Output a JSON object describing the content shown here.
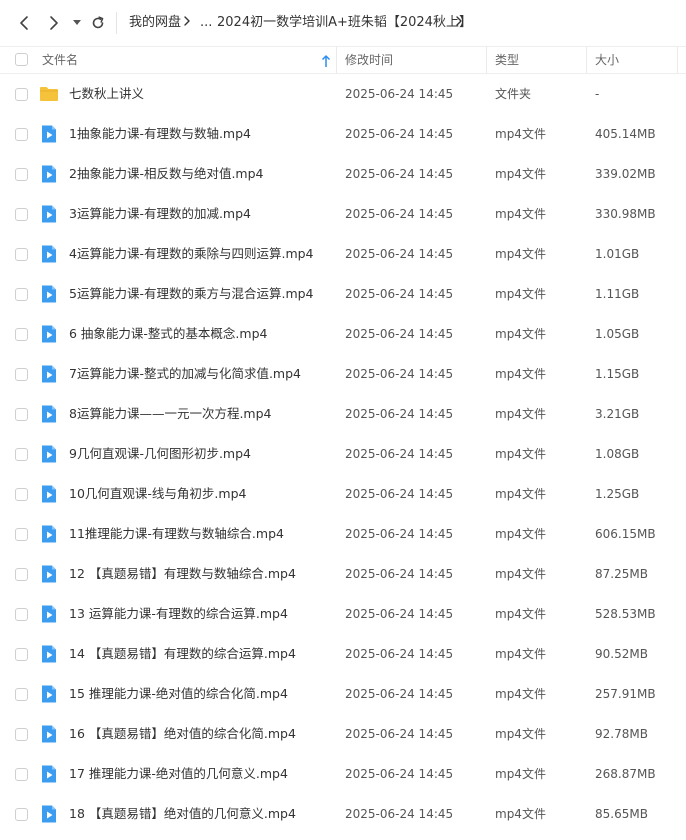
{
  "colors": {
    "folder": "#f5c23b",
    "video_icon": "#3c9cf0",
    "sort_arrow": "#2b8ef0",
    "text": "#333333"
  },
  "nav": {
    "back_icon": "chevron-left-icon",
    "forward_icon": "chevron-right-icon",
    "history_icon": "caret-down-icon",
    "refresh_icon": "refresh-icon",
    "breadcrumb": [
      "我的网盘",
      "...",
      "2024初一数学培训A+班朱韬【2024秋上】"
    ]
  },
  "header": {
    "name": "文件名",
    "time": "修改时间",
    "type": "类型",
    "size": "大小",
    "sort_icon": "sort-up-arrow-icon"
  },
  "files": [
    {
      "name": "七数秋上讲义",
      "time": "2025-06-24 14:45",
      "type": "文件夹",
      "size": "-",
      "kind": "folder"
    },
    {
      "name": "1抽象能力课-有理数与数轴.mp4",
      "time": "2025-06-24 14:45",
      "type": "mp4文件",
      "size": "405.14MB",
      "kind": "video"
    },
    {
      "name": "2抽象能力课-相反数与绝对值.mp4",
      "time": "2025-06-24 14:45",
      "type": "mp4文件",
      "size": "339.02MB",
      "kind": "video"
    },
    {
      "name": "3运算能力课-有理数的加减.mp4",
      "time": "2025-06-24 14:45",
      "type": "mp4文件",
      "size": "330.98MB",
      "kind": "video"
    },
    {
      "name": "4运算能力课-有理数的乘除与四则运算.mp4",
      "time": "2025-06-24 14:45",
      "type": "mp4文件",
      "size": "1.01GB",
      "kind": "video"
    },
    {
      "name": "5运算能力课-有理数的乘方与混合运算.mp4",
      "time": "2025-06-24 14:45",
      "type": "mp4文件",
      "size": "1.11GB",
      "kind": "video"
    },
    {
      "name": "6 抽象能力课-整式的基本概念.mp4",
      "time": "2025-06-24 14:45",
      "type": "mp4文件",
      "size": "1.05GB",
      "kind": "video"
    },
    {
      "name": "7运算能力课-整式的加减与化简求值.mp4",
      "time": "2025-06-24 14:45",
      "type": "mp4文件",
      "size": "1.15GB",
      "kind": "video"
    },
    {
      "name": "8运算能力课——一元一次方程.mp4",
      "time": "2025-06-24 14:45",
      "type": "mp4文件",
      "size": "3.21GB",
      "kind": "video"
    },
    {
      "name": "9几何直观课-几何图形初步.mp4",
      "time": "2025-06-24 14:45",
      "type": "mp4文件",
      "size": "1.08GB",
      "kind": "video"
    },
    {
      "name": "10几何直观课-线与角初步.mp4",
      "time": "2025-06-24 14:45",
      "type": "mp4文件",
      "size": "1.25GB",
      "kind": "video"
    },
    {
      "name": "11推理能力课-有理数与数轴综合.mp4",
      "time": "2025-06-24 14:45",
      "type": "mp4文件",
      "size": "606.15MB",
      "kind": "video"
    },
    {
      "name": "12 【真题易错】有理数与数轴综合.mp4",
      "time": "2025-06-24 14:45",
      "type": "mp4文件",
      "size": "87.25MB",
      "kind": "video"
    },
    {
      "name": "13 运算能力课-有理数的综合运算.mp4",
      "time": "2025-06-24 14:45",
      "type": "mp4文件",
      "size": "528.53MB",
      "kind": "video"
    },
    {
      "name": "14 【真题易错】有理数的综合运算.mp4",
      "time": "2025-06-24 14:45",
      "type": "mp4文件",
      "size": "90.52MB",
      "kind": "video"
    },
    {
      "name": "15 推理能力课-绝对值的综合化简.mp4",
      "time": "2025-06-24 14:45",
      "type": "mp4文件",
      "size": "257.91MB",
      "kind": "video"
    },
    {
      "name": "16 【真题易错】绝对值的综合化简.mp4",
      "time": "2025-06-24 14:45",
      "type": "mp4文件",
      "size": "92.78MB",
      "kind": "video"
    },
    {
      "name": "17 推理能力课-绝对值的几何意义.mp4",
      "time": "2025-06-24 14:45",
      "type": "mp4文件",
      "size": "268.87MB",
      "kind": "video"
    },
    {
      "name": "18 【真题易错】绝对值的几何意义.mp4",
      "time": "2025-06-24 14:45",
      "type": "mp4文件",
      "size": "85.65MB",
      "kind": "video"
    }
  ]
}
